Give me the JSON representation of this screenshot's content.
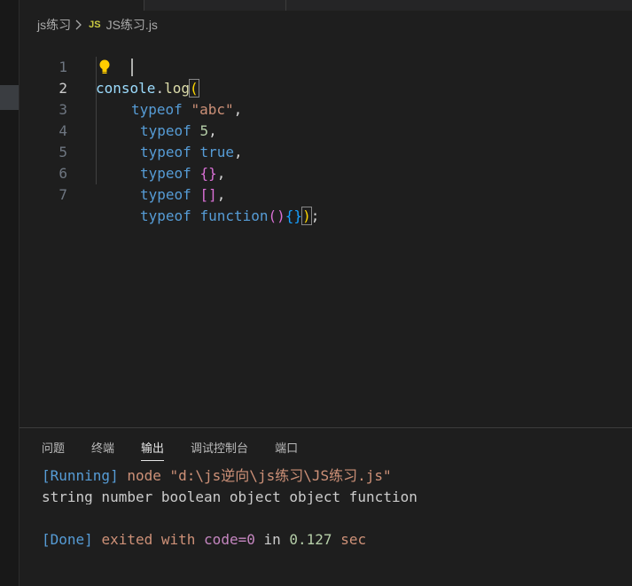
{
  "breadcrumb": {
    "folder": "js练习",
    "file_icon": "JS",
    "file": "JS练习.js"
  },
  "editor": {
    "lines": [
      {
        "num": "1"
      },
      {
        "num": "2"
      },
      {
        "num": "3"
      },
      {
        "num": "4"
      },
      {
        "num": "5"
      },
      {
        "num": "6"
      },
      {
        "num": "7"
      }
    ],
    "tokens": {
      "console": "console",
      "dot": ".",
      "log": "log",
      "paren_open": "(",
      "typeof": "typeof",
      "str_abc": "\"abc\"",
      "comma": ",",
      "num_5": "5",
      "true": "true",
      "brace_open": "{",
      "brace_close": "}",
      "bracket_open": "[",
      "bracket_close": "]",
      "function": "function",
      "fn_paren_open": "(",
      "fn_paren_close": ")",
      "paren_close": ")",
      "semicolon": ";"
    }
  },
  "panel": {
    "tabs": [
      "问题",
      "终端",
      "输出",
      "调试控制台",
      "端口"
    ],
    "active_tab": "输出",
    "output": {
      "running_tag": "[Running]",
      "running_cmd": "node \"d:\\js逆向\\js练习\\JS练习.js\"",
      "result": "string number boolean object object function",
      "done_tag": "[Done]",
      "exited_text": "exited with",
      "code_text": "code=0",
      "in_text": "in",
      "time_value": "0.127",
      "time_unit": "seconds"
    }
  },
  "colors": {
    "background": "#1e1e1e",
    "keyword": "#569cd6",
    "string": "#ce9178",
    "bracket_level1": "#ffd700",
    "bracket_level2": "#da70d6",
    "bracket_level3": "#179fff"
  }
}
